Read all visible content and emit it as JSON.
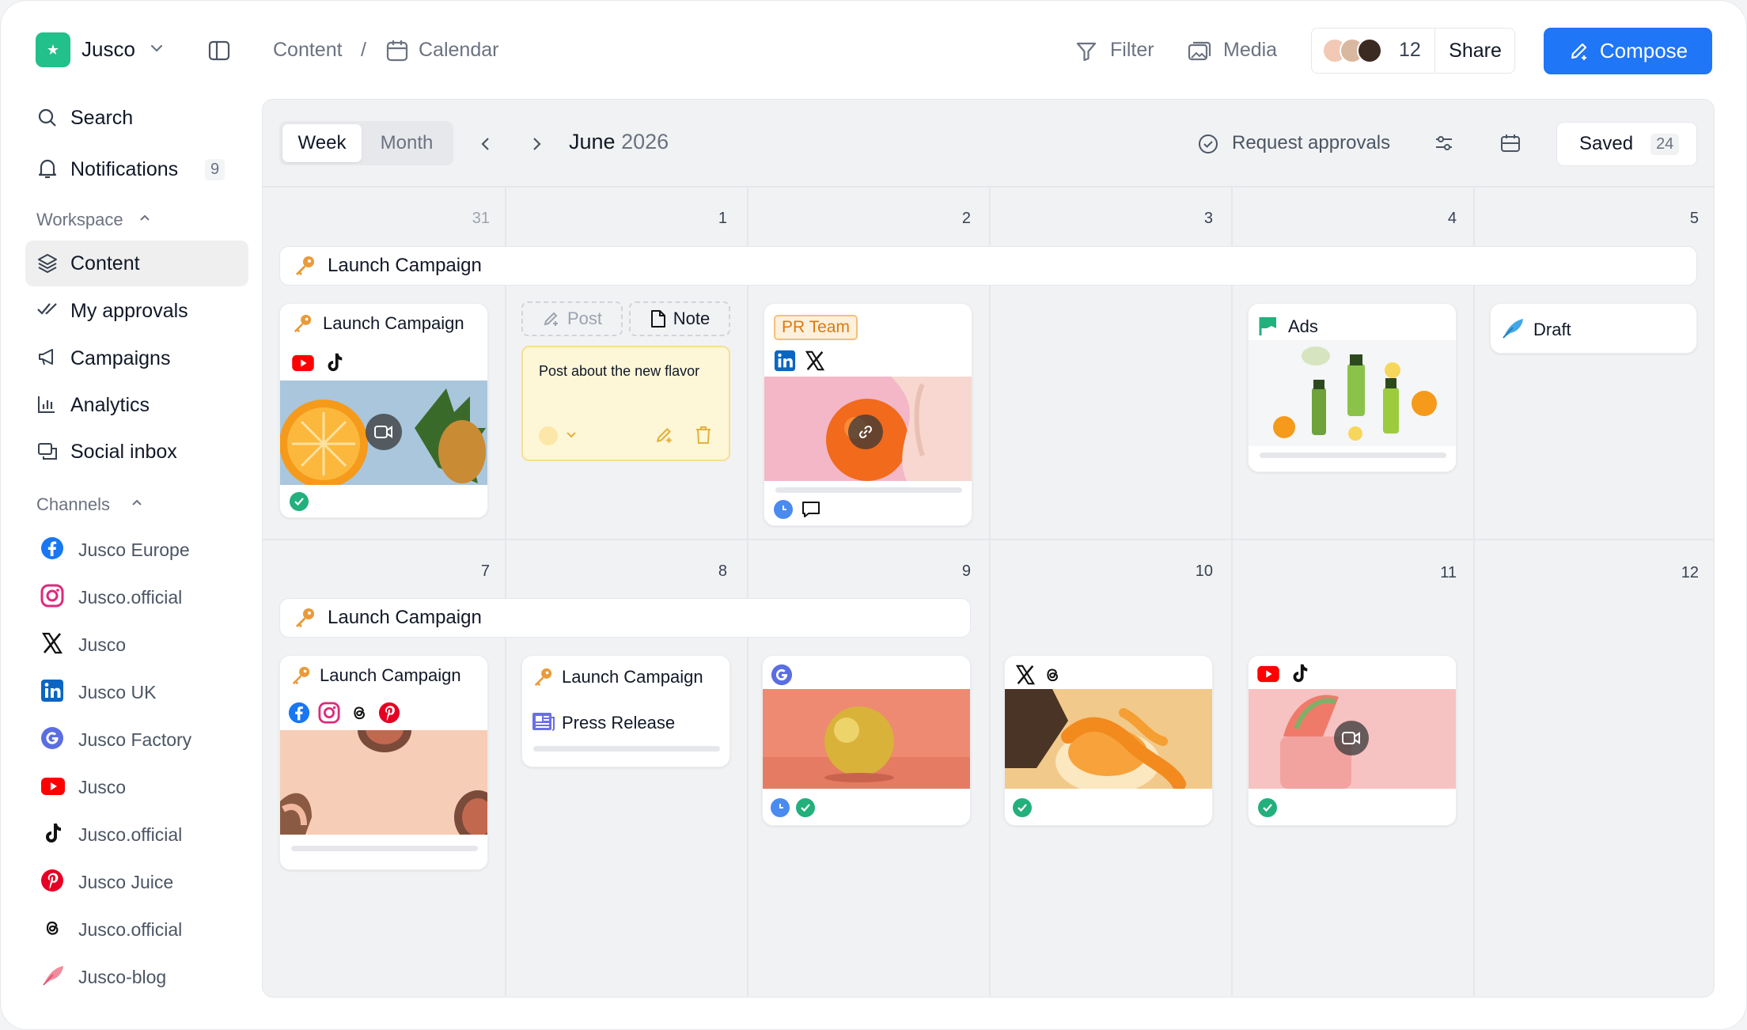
{
  "workspace": {
    "name": "Jusco"
  },
  "breadcrumb": {
    "section": "Content",
    "separator": "/",
    "page": "Calendar"
  },
  "toolbar": {
    "filter": "Filter",
    "media": "Media",
    "people_count": "12",
    "share": "Share",
    "compose": "Compose"
  },
  "sidebar": {
    "search": "Search",
    "notifications": "Notifications",
    "notifications_count": "9",
    "workspace_heading": "Workspace",
    "items": [
      {
        "label": "Content",
        "active": true
      },
      {
        "label": "My approvals"
      },
      {
        "label": "Campaigns"
      },
      {
        "label": "Analytics"
      },
      {
        "label": "Social inbox"
      }
    ],
    "channels_heading": "Channels",
    "channels": [
      {
        "label": "Jusco Europe",
        "icon": "facebook-icon"
      },
      {
        "label": "Jusco.official",
        "icon": "instagram-icon"
      },
      {
        "label": "Jusco",
        "icon": "x-icon"
      },
      {
        "label": "Jusco UK",
        "icon": "linkedin-icon"
      },
      {
        "label": "Jusco Factory",
        "icon": "google-icon"
      },
      {
        "label": "Jusco",
        "icon": "youtube-icon"
      },
      {
        "label": "Jusco.official",
        "icon": "tiktok-icon"
      },
      {
        "label": "Jusco Juice",
        "icon": "pinterest-icon"
      },
      {
        "label": "Jusco.official",
        "icon": "threads-icon"
      },
      {
        "label": "Jusco-blog",
        "icon": "feather-icon"
      }
    ]
  },
  "calendar": {
    "view_week": "Week",
    "view_month": "Month",
    "month": "June",
    "year": "2026",
    "request_approvals": "Request approvals",
    "saved_label": "Saved",
    "saved_count": "24",
    "week1_days": [
      "31",
      "1",
      "2",
      "3",
      "4",
      "5"
    ],
    "week2_days": [
      "7",
      "8",
      "9",
      "10",
      "11",
      "12"
    ],
    "week1_banner": "Launch Campaign",
    "week2_banner": "Launch Campaign",
    "cards": {
      "c1": "Launch Campaign",
      "post_tab": "Post",
      "note_tab": "Note",
      "note_text": "Post about the new flavor",
      "pr_tag": "PR Team",
      "ads": "Ads",
      "draft": "Draft",
      "c7": "Launch Campaign",
      "c8": "Launch Campaign",
      "press_release": "Press Release"
    }
  },
  "colors": {
    "accent": "#1f76f6",
    "brand": "#22c08a",
    "campaign": "#e99a3a",
    "approved": "#22b07d",
    "scheduled": "#4a8bf0"
  }
}
